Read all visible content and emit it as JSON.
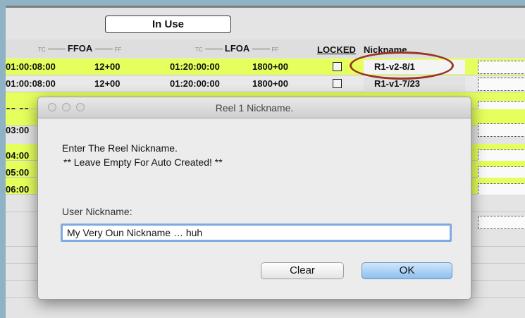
{
  "app": {
    "in_use_label": "In Use",
    "headers": {
      "tc1": "TC",
      "ffoa": "FFOA",
      "ff1": "FF",
      "tc2": "TC",
      "lfoa": "LFOA",
      "ff2": "FF",
      "locked": "LOCKED",
      "nickname": "Nickname"
    },
    "rows": [
      {
        "ffoa_tc": "01:00:08:00",
        "ffoa_ff": "12+00",
        "lfoa_tc": "01:20:00:00",
        "lfoa_ff": "1800+00",
        "nickname": "R1-v2-8/1"
      },
      {
        "ffoa_tc": "01:00:08:00",
        "ffoa_ff": "12+00",
        "lfoa_tc": "01:20:00:00",
        "lfoa_ff": "1800+00",
        "nickname": "R1-v1-7/23"
      },
      {
        "ffoa_tc": "02:00"
      },
      {
        "ffoa_tc": "03:00"
      },
      {
        "ffoa_tc": "04:00"
      },
      {
        "ffoa_tc": "05:00"
      },
      {
        "ffoa_tc": "06:00"
      }
    ],
    "highlight_color": "#9a3524",
    "row_highlight_color": "#e6ff5c"
  },
  "dialog": {
    "title": "Reel 1 Nickname.",
    "message_line1": "Enter The Reel Nickname.",
    "message_line2": "** Leave Empty For Auto Created! **",
    "field_label": "User Nickname:",
    "field_value": "My Very Oun Nickname … huh",
    "clear_label": "Clear",
    "ok_label": "OK"
  }
}
